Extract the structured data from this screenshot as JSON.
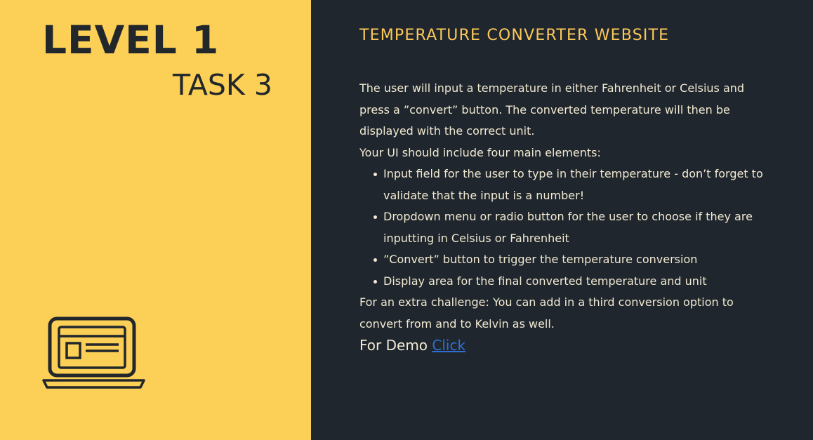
{
  "left": {
    "level": "LEVEL 1",
    "task": "TASK 3",
    "icon": "laptop-icon"
  },
  "right": {
    "heading": "TEMPERATURE CONVERTER WEBSITE",
    "intro": "The user will input a temperature in either Fahrenheit or Celsius and press a ”convert” button. The converted temperature will then be displayed with the correct unit.",
    "elements_intro": "Your UI should include four main elements:",
    "bullets": [
      "Input field for the user to type in their temperature - don’t forget to validate that the input is a number!",
      "Dropdown menu or radio button for the user to choose if they are inputting in Celsius or Fahrenheit",
      "”Convert” button to trigger the temperature conversion",
      "Display area for the final converted temperature and unit"
    ],
    "extra": "For an extra challenge: You can add in a third conversion option to convert from and to Kelvin as well.",
    "demo_label": "For Demo",
    "demo_link": "Click"
  },
  "colors": {
    "left_bg": "#fccf56",
    "right_bg": "#20262d",
    "heading": "#fcc85a",
    "text": "#f1ead3",
    "link": "#2f6fd2"
  }
}
